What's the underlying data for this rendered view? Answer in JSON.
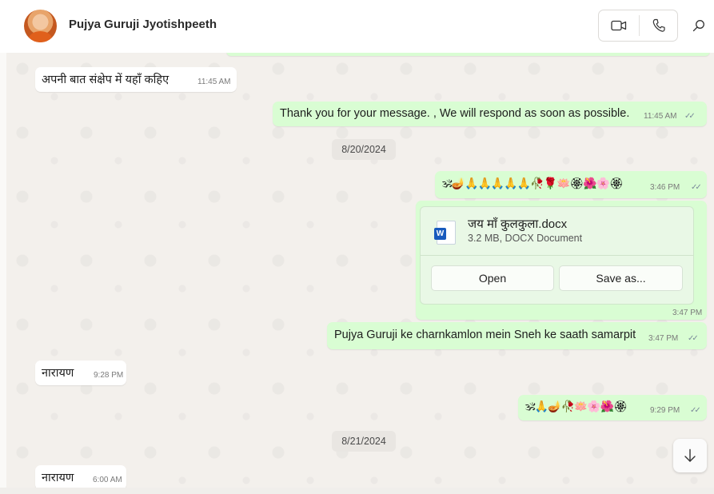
{
  "header": {
    "contact_name": "Pujya Guruji Jyotishpeeth",
    "icons": [
      "avatar",
      "video-call-icon",
      "voice-call-icon",
      "search-icon"
    ]
  },
  "messages": {
    "m1": {
      "text": "अपनी बात संक्षेप में यहाँ कहिए",
      "time": "11:45 AM"
    },
    "m2": {
      "text": "Thank you for your message. , We will respond as soon as possible.",
      "time": "11:45 AM"
    },
    "date1": "8/20/2024",
    "m3": {
      "text": "🕉🪔🙏🙏🙏🙏🙏🥀🌹🪷🏵🌺🌸🏵",
      "time": "3:46 PM"
    },
    "doc": {
      "filename": "जय माँ कुलकुला.docx",
      "meta": "3.2 MB, DOCX Document",
      "open_label": "Open",
      "save_label": "Save as...",
      "time": "3:47 PM",
      "icon": "word-document-icon"
    },
    "m4": {
      "text": "Pujya Guruji ke charnkamlon mein Sneh ke saath samarpit",
      "time": "3:47 PM"
    },
    "m5": {
      "text": "नारायण",
      "time": "9:28 PM"
    },
    "m6": {
      "text": "🕉🙏🪔🥀🪷🌸🌺🏵",
      "time": "9:29 PM"
    },
    "date2": "8/21/2024",
    "m7": {
      "text": "नारायण",
      "time": "6:00 AM"
    }
  },
  "colors": {
    "incoming_bubble": "#ffffff",
    "outgoing_bubble": "#d9fdd3",
    "word_blue": "#185abd"
  }
}
